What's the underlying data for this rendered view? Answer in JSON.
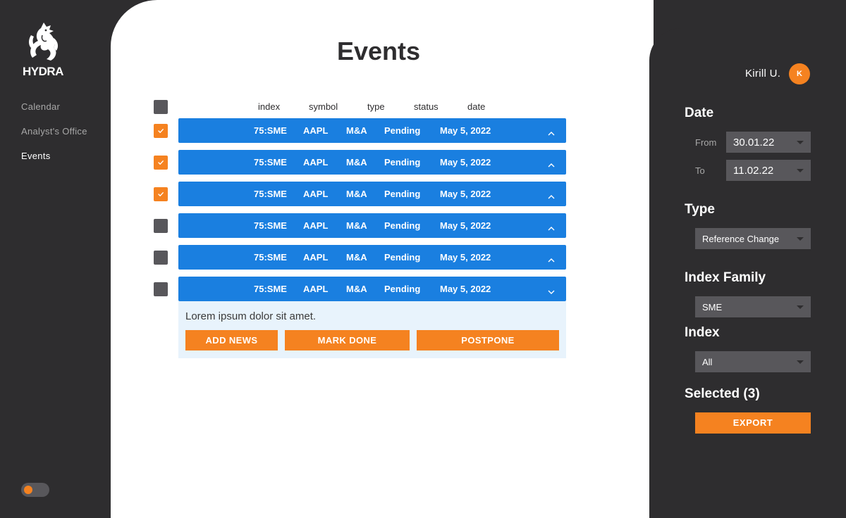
{
  "brand": {
    "name": "HYDRA"
  },
  "sidebar": {
    "items": [
      {
        "label": "Calendar"
      },
      {
        "label": "Analyst's Office"
      },
      {
        "label": "Events"
      }
    ]
  },
  "main": {
    "title": "Events",
    "columns": [
      "index",
      "symbol",
      "type",
      "status",
      "date"
    ],
    "rows": [
      {
        "checked": true,
        "index": "75:SME",
        "symbol": "AAPL",
        "type": "M&A",
        "status": "Pending",
        "date": "May 5, 2022",
        "expanded": false
      },
      {
        "checked": true,
        "index": "75:SME",
        "symbol": "AAPL",
        "type": "M&A",
        "status": "Pending",
        "date": "May 5, 2022",
        "expanded": false
      },
      {
        "checked": true,
        "index": "75:SME",
        "symbol": "AAPL",
        "type": "M&A",
        "status": "Pending",
        "date": "May 5, 2022",
        "expanded": false
      },
      {
        "checked": false,
        "index": "75:SME",
        "symbol": "AAPL",
        "type": "M&A",
        "status": "Pending",
        "date": "May 5, 2022",
        "expanded": false
      },
      {
        "checked": false,
        "index": "75:SME",
        "symbol": "AAPL",
        "type": "M&A",
        "status": "Pending",
        "date": "May 5, 2022",
        "expanded": false
      },
      {
        "checked": false,
        "index": "75:SME",
        "symbol": "AAPL",
        "type": "M&A",
        "status": "Pending",
        "date": "May 5, 2022",
        "expanded": true
      }
    ],
    "details": {
      "text": "Lorem ipsum dolor sit amet.",
      "buttons": [
        "ADD NEWS",
        "MARK DONE",
        "POSTPONE"
      ]
    }
  },
  "user": {
    "name": "Kirill U.",
    "initial": "K"
  },
  "filters": {
    "date": {
      "title": "Date",
      "from_label": "From",
      "from_value": "30.01.22",
      "to_label": "To",
      "to_value": "11.02.22"
    },
    "type": {
      "title": "Type",
      "value": "Reference Change"
    },
    "index_family": {
      "title": "Index Family",
      "value": "SME"
    },
    "index": {
      "title": "Index",
      "value": "All"
    }
  },
  "selection": {
    "title": "Selected (3)",
    "export_label": "EXPORT"
  },
  "colors": {
    "accent": "#f58220",
    "primary": "#1a7fe0",
    "dark": "#2e2d2f"
  }
}
